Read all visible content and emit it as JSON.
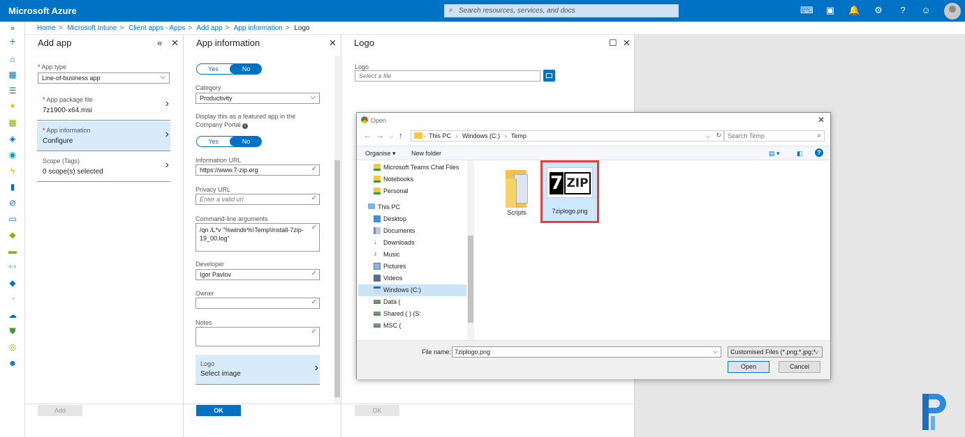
{
  "topbar": {
    "brand": "Microsoft Azure",
    "search_placeholder": "Search resources, services, and docs",
    "icons": [
      "cloud-shell-icon",
      "directory-icon",
      "notifications-icon",
      "settings-icon",
      "help-icon",
      "feedback-icon",
      "avatar"
    ]
  },
  "rail": {
    "expand": "»",
    "icons": [
      "create-icon",
      "home-icon",
      "dashboard-icon",
      "all-services-icon",
      "favorites-icon",
      "grid-icon",
      "cube-icon",
      "globe-icon",
      "lightning-icon",
      "sql-icon",
      "satellite-icon",
      "monitor-icon",
      "diamond-icon",
      "storage-icon",
      "connections-icon",
      "devops-icon",
      "gauge-icon",
      "cloud-upload-icon",
      "shield-icon",
      "circle-icon",
      "user-icon"
    ]
  },
  "breadcrumb": [
    "Home",
    "Microsoft Intune",
    "Client apps - Apps",
    "Add app",
    "App information",
    "Logo"
  ],
  "add_app": {
    "title": "Add app",
    "app_type_label": "App type",
    "app_type_value": "Line-of-business app",
    "items": [
      {
        "label": "App package file",
        "value": "7z1900-x64.msi",
        "required": true
      },
      {
        "label": "App information",
        "value": "Configure",
        "required": true
      },
      {
        "label": "Scope (Tags)",
        "value": "0 scope(s) selected",
        "required": false
      }
    ],
    "add_button": "Add"
  },
  "app_info": {
    "title": "App information",
    "toggle1": {
      "yes": "Yes",
      "no": "No"
    },
    "category_label": "Category",
    "category_value": "Productivity",
    "featured_label": "Display this as a featured app in the Company Portal",
    "toggle2": {
      "yes": "Yes",
      "no": "No"
    },
    "info_url_label": "Information URL",
    "info_url_value": "https://www.7-zip.org",
    "privacy_label": "Privacy URL",
    "privacy_placeholder": "Enter a valid url",
    "cmd_label": "Command-line arguments",
    "cmd_value": "/qn /L*v \"%windir%\\Temp\\Install-7zip-19_00.log\"",
    "developer_label": "Developer",
    "developer_value": "Igor Pavlov",
    "owner_label": "Owner",
    "notes_label": "Notes",
    "logo_label": "Logo",
    "logo_value": "Select image",
    "ok_button": "OK"
  },
  "logo_blade": {
    "title": "Logo",
    "field_label": "Logo",
    "field_placeholder": "Select a file",
    "ok_button": "OK"
  },
  "dialog": {
    "title": "Open",
    "path": [
      "This PC",
      "Windows (C:)",
      "Temp"
    ],
    "search_placeholder": "Search Temp",
    "organise": "Organise ▾",
    "new_folder": "New folder",
    "tree": [
      {
        "label": "Microsoft Teams Chat Files",
        "icon": "onedrive-folder-icon"
      },
      {
        "label": "Notebooks",
        "icon": "onedrive-folder-icon"
      },
      {
        "label": "Personal",
        "icon": "onedrive-folder-icon"
      },
      {
        "label": "This PC",
        "icon": "computer-icon"
      },
      {
        "label": "Desktop",
        "icon": "desktop-icon"
      },
      {
        "label": "Documents",
        "icon": "documents-icon"
      },
      {
        "label": "Downloads",
        "icon": "downloads-icon"
      },
      {
        "label": "Music",
        "icon": "music-icon"
      },
      {
        "label": "Pictures",
        "icon": "pictures-icon"
      },
      {
        "label": "Videos",
        "icon": "videos-icon"
      },
      {
        "label": "Windows (C:)",
        "icon": "drive-icon",
        "selected": true
      },
      {
        "label": "Data (",
        "icon": "network-drive-icon"
      },
      {
        "label": "Shared (                     ) (S:",
        "icon": "network-drive-icon"
      },
      {
        "label": "MSC (",
        "icon": "network-drive-icon"
      }
    ],
    "files": [
      {
        "name": "Scripts",
        "type": "folder"
      },
      {
        "name": "7ziplogo.png",
        "type": "image",
        "image_text": "7ZIP",
        "highlighted": true
      }
    ],
    "file_name_label": "File name:",
    "file_name_value": "7ziplogo.png",
    "filter_value": "Customised Files (*.png;*.jpg;*.",
    "open_button": "Open",
    "cancel_button": "Cancel"
  },
  "colors": {
    "azure_blue": "#0072c6",
    "highlight_red": "#e0403f",
    "selected_bg": "#d8ebfa"
  }
}
